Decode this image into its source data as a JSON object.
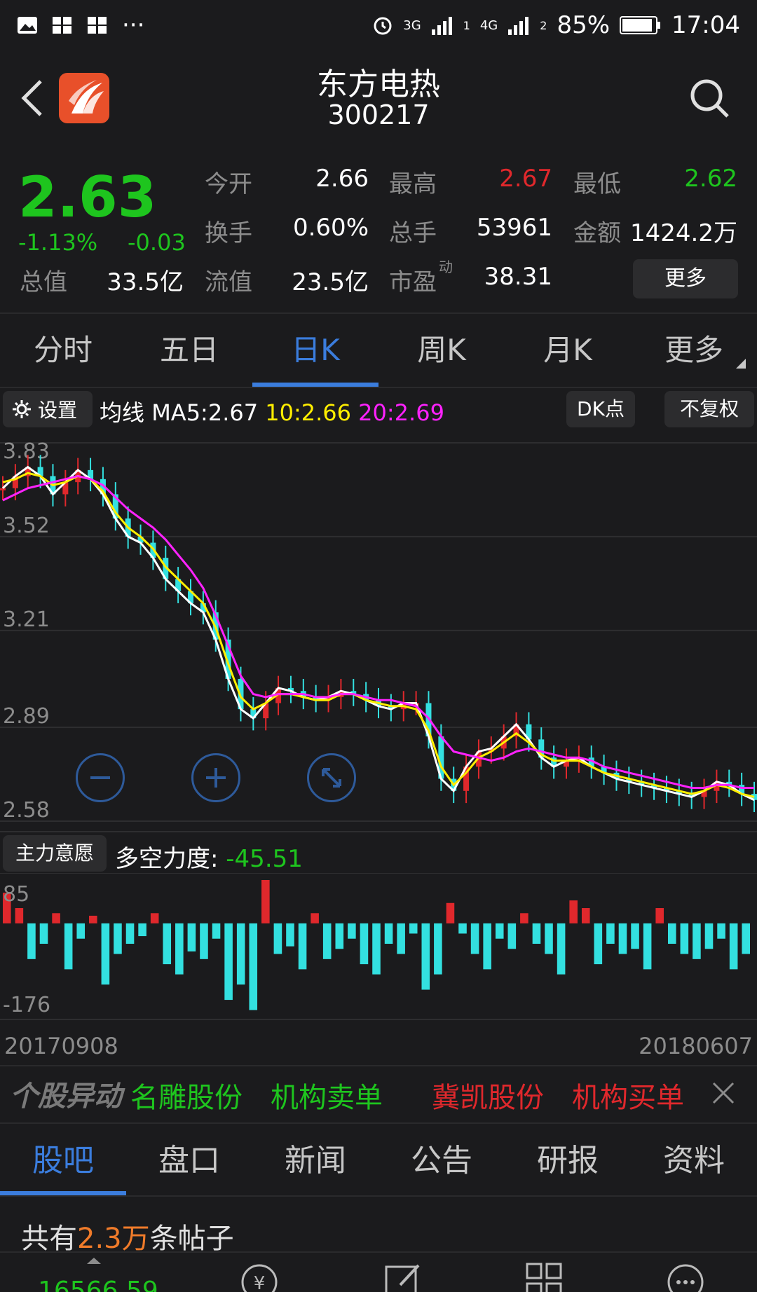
{
  "status_bar": {
    "battery": "85%",
    "time": "17:04",
    "net1": "3G",
    "net2": "4G",
    "sim1": "1",
    "sim2": "2",
    "more": "···"
  },
  "header": {
    "stock_name": "东方电热",
    "stock_code": "300217"
  },
  "quote": {
    "price": "2.63",
    "change_pct": "-1.13%",
    "change_abs": "-0.03",
    "total_value_label": "总值",
    "total_value": "33.5亿",
    "open_label": "今开",
    "open": "2.66",
    "high_label": "最高",
    "high": "2.67",
    "low_label": "最低",
    "low": "2.62",
    "turnover_label": "换手",
    "turnover": "0.60%",
    "volume_label": "总手",
    "volume": "53961",
    "amount_label": "金额",
    "amount": "1424.2万",
    "float_label": "流值",
    "float_value": "23.5亿",
    "pe_label": "市盈",
    "pe_sup": "动",
    "pe": "38.31",
    "more_button": "更多"
  },
  "colors": {
    "up": "#e0282c",
    "down": "#1ec51e",
    "accent": "#3b7ddd",
    "ma5": "#ffffff",
    "ma10": "#ffee00",
    "ma20": "#ff22ff",
    "candle_down": "#33e0e0",
    "price_text_orange": "#f07b2a"
  },
  "period_tabs": [
    "分时",
    "五日",
    "日K",
    "周K",
    "月K",
    "更多"
  ],
  "active_period": "日K",
  "ma_bar": {
    "settings_label": "设置",
    "prefix": "均线",
    "ma5": "MA5:2.67",
    "ma10": "10:2.66",
    "ma20": "20:2.69",
    "dk_button": "DK点",
    "adjust_button": "不复权"
  },
  "indicator": {
    "button": "主力意愿",
    "label": "多空力度:",
    "value": "-45.51"
  },
  "date_start": "20170908",
  "date_end": "20180607",
  "news": {
    "title": "个股异动",
    "items": [
      {
        "text": "名雕股份",
        "color": "#1ec51e"
      },
      {
        "text": "机构卖单",
        "color": "#1ec51e"
      },
      {
        "text": "冀凯股份",
        "color": "#e0282c"
      },
      {
        "text": "机构买单",
        "color": "#e0282c"
      }
    ]
  },
  "sub_tabs": [
    "股吧",
    "盘口",
    "新闻",
    "公告",
    "研报",
    "资料"
  ],
  "active_sub_tab": "股吧",
  "posts": {
    "prefix": "共有",
    "count": "2.3万",
    "suffix": "条帖子"
  },
  "bottom_bar": {
    "index_value": "16566.59"
  },
  "chart_data": [
    {
      "type": "candlestick",
      "title": "",
      "ylim": [
        2.58,
        3.83
      ],
      "y_ticks": [
        "3.83",
        "3.52",
        "3.21",
        "2.89",
        "2.58"
      ],
      "x_range": [
        "20170908",
        "20180607"
      ],
      "ma_lines": [
        {
          "name": "MA5",
          "color": "#ffffff",
          "values": [
            3.68,
            3.72,
            3.75,
            3.72,
            3.66,
            3.7,
            3.74,
            3.71,
            3.66,
            3.58,
            3.52,
            3.5,
            3.45,
            3.38,
            3.34,
            3.3,
            3.27,
            3.18,
            3.05,
            2.95,
            2.92,
            2.97,
            3.02,
            3.01,
            2.99,
            2.98,
            2.99,
            3.01,
            3.0,
            2.98,
            2.96,
            2.95,
            2.97,
            2.97,
            2.86,
            2.72,
            2.68,
            2.76,
            2.81,
            2.82,
            2.86,
            2.9,
            2.85,
            2.79,
            2.76,
            2.78,
            2.79,
            2.76,
            2.74,
            2.72,
            2.71,
            2.7,
            2.69,
            2.68,
            2.67,
            2.66,
            2.68,
            2.71,
            2.7,
            2.67,
            2.65
          ]
        },
        {
          "name": "MA10",
          "color": "#ffee00",
          "values": [
            3.7,
            3.71,
            3.73,
            3.72,
            3.69,
            3.7,
            3.72,
            3.71,
            3.67,
            3.6,
            3.55,
            3.52,
            3.48,
            3.42,
            3.38,
            3.34,
            3.3,
            3.22,
            3.1,
            2.99,
            2.95,
            2.97,
            3.0,
            3.0,
            2.99,
            2.98,
            2.98,
            3.0,
            3.0,
            2.98,
            2.97,
            2.96,
            2.96,
            2.95,
            2.88,
            2.76,
            2.7,
            2.74,
            2.79,
            2.81,
            2.84,
            2.87,
            2.84,
            2.8,
            2.78,
            2.78,
            2.78,
            2.76,
            2.74,
            2.73,
            2.72,
            2.71,
            2.7,
            2.69,
            2.68,
            2.67,
            2.68,
            2.7,
            2.69,
            2.67,
            2.66
          ]
        },
        {
          "name": "MA20",
          "color": "#ff22ff",
          "values": [
            3.64,
            3.66,
            3.68,
            3.69,
            3.7,
            3.71,
            3.72,
            3.71,
            3.69,
            3.65,
            3.61,
            3.58,
            3.55,
            3.51,
            3.46,
            3.41,
            3.35,
            3.26,
            3.16,
            3.06,
            3.0,
            2.99,
            3.0,
            3.0,
            3.0,
            2.99,
            2.99,
            3.0,
            3.0,
            2.99,
            2.98,
            2.98,
            2.97,
            2.96,
            2.92,
            2.86,
            2.81,
            2.8,
            2.79,
            2.78,
            2.79,
            2.81,
            2.82,
            2.81,
            2.8,
            2.79,
            2.79,
            2.78,
            2.76,
            2.75,
            2.74,
            2.73,
            2.72,
            2.71,
            2.7,
            2.69,
            2.69,
            2.7,
            2.7,
            2.69,
            2.69
          ]
        }
      ]
    },
    {
      "type": "bar",
      "title": "",
      "ylim": [
        -176,
        85
      ],
      "y_ticks": [
        "85",
        "-176"
      ],
      "values": [
        60,
        30,
        -70,
        -40,
        20,
        -90,
        -30,
        15,
        -120,
        -60,
        -40,
        -25,
        20,
        -80,
        -100,
        -55,
        -70,
        -30,
        -150,
        -120,
        -170,
        85,
        -60,
        -45,
        -90,
        20,
        -70,
        -50,
        -30,
        -80,
        -100,
        -40,
        -60,
        -20,
        -130,
        -100,
        40,
        -20,
        -60,
        -90,
        -30,
        -50,
        20,
        -40,
        -60,
        -100,
        45,
        30,
        -80,
        -40,
        -60,
        -50,
        -90,
        30,
        -40,
        -60,
        -70,
        -50,
        -30,
        -90,
        -60
      ]
    }
  ]
}
